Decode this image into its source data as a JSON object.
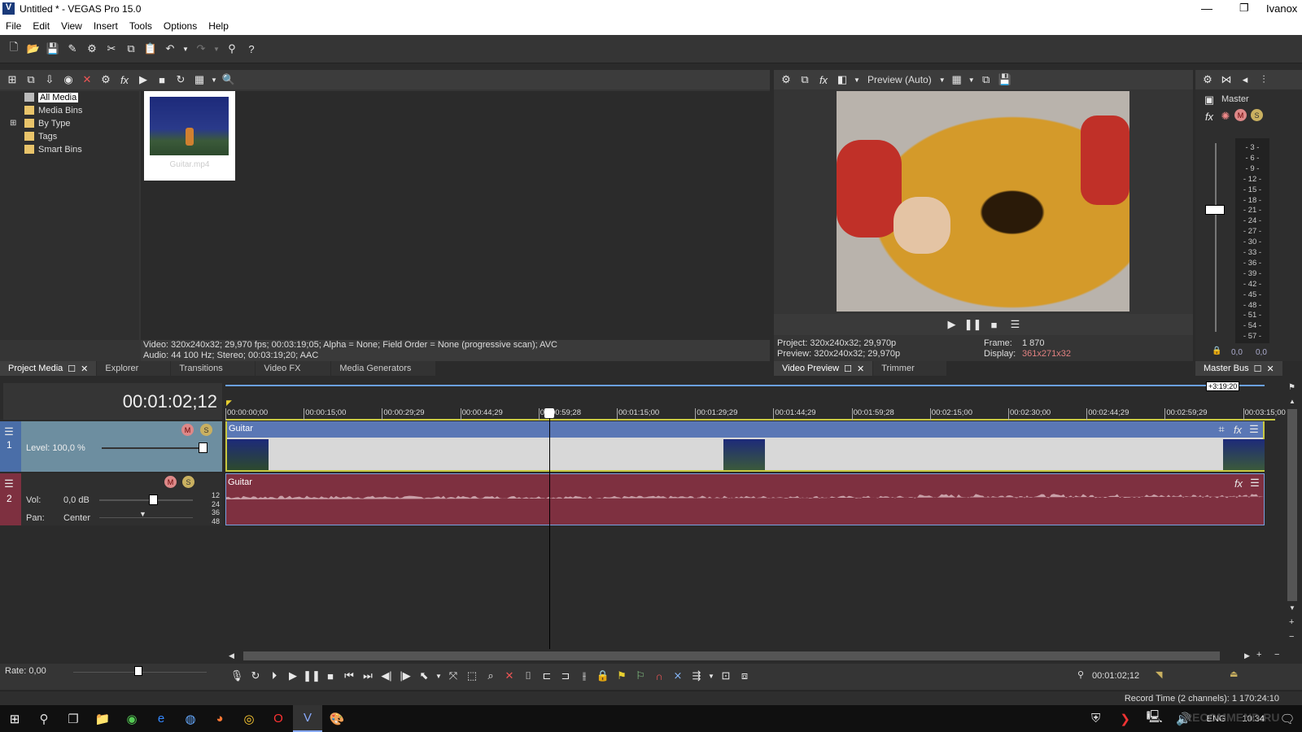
{
  "window": {
    "title": "Untitled * - VEGAS Pro 15.0",
    "user": "Ivanox",
    "app_icon": "V"
  },
  "menu": [
    "File",
    "Edit",
    "View",
    "Insert",
    "Tools",
    "Options",
    "Help"
  ],
  "project_media": {
    "tree": [
      "All Media",
      "Media Bins",
      "By Type",
      "Tags",
      "Smart Bins"
    ],
    "selected": "All Media",
    "media_item": "Guitar.mp4",
    "info_video": "Video: 320x240x32; 29,970 fps; 00:03:19;05; Alpha = None; Field Order = None (progressive scan); AVC",
    "info_audio": "Audio: 44 100 Hz; Stereo; 00:03:19;20; AAC"
  },
  "upper_tabs": [
    "Project Media",
    "Explorer",
    "Transitions",
    "Video FX",
    "Media Generators"
  ],
  "preview": {
    "mode": "Preview (Auto)",
    "project_label": "Project:",
    "project_value": "320x240x32; 29,970p",
    "preview_label": "Preview:",
    "preview_value": "320x240x32; 29,970p",
    "frame_label": "Frame:",
    "frame_value": "1 870",
    "display_label": "Display:",
    "display_value": "361x271x32",
    "tabs": [
      "Video Preview",
      "Trimmer"
    ]
  },
  "master": {
    "title": "Master",
    "scale": [
      "3",
      "6",
      "9",
      "12",
      "15",
      "18",
      "21",
      "24",
      "27",
      "30",
      "33",
      "36",
      "39",
      "42",
      "45",
      "48",
      "51",
      "54",
      "57"
    ],
    "left": "0,0",
    "right": "0,0",
    "tab": "Master Bus"
  },
  "timeline": {
    "timecode": "00:01:02;12",
    "end_marker": "+3:19;20",
    "ruler": [
      "00:00:00;00",
      "00:00:15;00",
      "00:00:29;29",
      "00:00:44;29",
      "00:00:59;28",
      "00:01:15;00",
      "00:01:29;29",
      "00:01:44;29",
      "00:01:59;28",
      "00:02:15;00",
      "00:02:30;00",
      "00:02:44;29",
      "00:02:59;29",
      "00:03:15;00"
    ],
    "tracks": [
      {
        "number": "1",
        "type": "video",
        "level_label": "Level: 100,0 %",
        "level": 100,
        "clip": "Guitar"
      },
      {
        "number": "2",
        "type": "audio",
        "vol_label": "Vol:",
        "vol_value": "0,0 dB",
        "pan_label": "Pan:",
        "pan_value": "Center",
        "clip": "Guitar",
        "db_scale": [
          "12",
          "24",
          "36",
          "48"
        ]
      }
    ]
  },
  "transport": {
    "rate": "Rate: 0,00",
    "cursor_time": "00:01:02;12"
  },
  "status": {
    "record_time": "Record Time (2 channels): 1 170:24:10"
  },
  "taskbar": {
    "lang": "ENG",
    "clock": "10:34",
    "watermark": "RECOMMEND.RU"
  },
  "colors": {
    "video_track": "#5a77b5",
    "audio_track": "#7e3040",
    "display_value": "#e08080"
  }
}
